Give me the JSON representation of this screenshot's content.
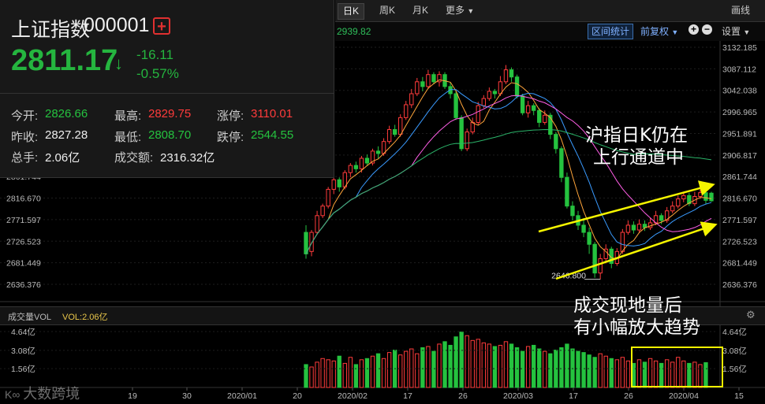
{
  "toolbar": {
    "tabs": [
      "日K",
      "周K",
      "月K",
      "更多"
    ],
    "active": "日K",
    "draw_label": "画线"
  },
  "subbar": {
    "ma_value": "2939.82",
    "range_stats": "区间统计",
    "adjust": "前复权",
    "settings": "设置"
  },
  "quote": {
    "name": "上证指数",
    "code": "000001",
    "price": "2811.17",
    "change": "-16.11",
    "change_pct": "-0.57%",
    "rows": [
      [
        {
          "label": "今开:",
          "value": "2826.66",
          "color": "green"
        },
        {
          "label": "最高:",
          "value": "2829.75",
          "color": "red"
        },
        {
          "label": "涨停:",
          "value": "3110.01",
          "color": "red"
        }
      ],
      [
        {
          "label": "昨收:",
          "value": "2827.28",
          "color": "white"
        },
        {
          "label": "最低:",
          "value": "2808.70",
          "color": "green"
        },
        {
          "label": "跌停:",
          "value": "2544.55",
          "color": "green"
        }
      ],
      [
        {
          "label": "总手:",
          "value": "2.06亿",
          "color": "white"
        },
        {
          "label": "成交额:",
          "value": "2316.32亿",
          "color": "white"
        }
      ]
    ]
  },
  "volume_header": {
    "title": "成交量VOL",
    "vol": "VOL:2.06亿"
  },
  "annotations": {
    "top_line1": "沪指日K仍在",
    "top_line2": "上行通道中",
    "bottom_line1": "成交现地量后",
    "bottom_line2": "有小幅放大趋势",
    "low_label": "2646.800"
  },
  "watermark": "大数跨境",
  "colors": {
    "up": "#ff3b3b",
    "down": "#25c23f",
    "arrow": "#f5f500",
    "box": "#f5f500"
  },
  "chart_data": {
    "type": "candlestick",
    "price_axis_ticks": [
      "3132.185",
      "3087.112",
      "3042.038",
      "2996.965",
      "2951.891",
      "2906.817",
      "2861.744",
      "2816.670",
      "2771.597",
      "2726.523",
      "2681.449",
      "2636.376"
    ],
    "left_price_ticks": [
      "2861.744",
      "2816.670",
      "2771.597",
      "2726.523",
      "2681.449",
      "2636.376"
    ],
    "price_ylim": [
      2636.376,
      3132.185
    ],
    "volume_axis_ticks": [
      "4.64亿",
      "3.08亿",
      "1.56亿"
    ],
    "x_tick_labels": [
      "19",
      "30",
      "2020/01",
      "20",
      "2020/02",
      "17",
      "26",
      "2020/03",
      "17",
      "26",
      "2020/04",
      "15"
    ],
    "candles": [
      {
        "o": 2745,
        "c": 2700,
        "h": 2760,
        "l": 2690
      },
      {
        "o": 2705,
        "c": 2745,
        "h": 2750,
        "l": 2695
      },
      {
        "o": 2745,
        "c": 2780,
        "h": 2790,
        "l": 2740
      },
      {
        "o": 2780,
        "c": 2800,
        "h": 2805,
        "l": 2775
      },
      {
        "o": 2800,
        "c": 2835,
        "h": 2840,
        "l": 2795
      },
      {
        "o": 2835,
        "c": 2855,
        "h": 2865,
        "l": 2825
      },
      {
        "o": 2855,
        "c": 2840,
        "h": 2860,
        "l": 2830
      },
      {
        "o": 2840,
        "c": 2870,
        "h": 2875,
        "l": 2835
      },
      {
        "o": 2870,
        "c": 2885,
        "h": 2890,
        "l": 2860
      },
      {
        "o": 2885,
        "c": 2878,
        "h": 2893,
        "l": 2870
      },
      {
        "o": 2878,
        "c": 2900,
        "h": 2905,
        "l": 2870
      },
      {
        "o": 2900,
        "c": 2890,
        "h": 2908,
        "l": 2885
      },
      {
        "o": 2890,
        "c": 2915,
        "h": 2920,
        "l": 2885
      },
      {
        "o": 2915,
        "c": 2910,
        "h": 2925,
        "l": 2900
      },
      {
        "o": 2910,
        "c": 2935,
        "h": 2942,
        "l": 2905
      },
      {
        "o": 2935,
        "c": 2960,
        "h": 2968,
        "l": 2930
      },
      {
        "o": 2960,
        "c": 2950,
        "h": 2970,
        "l": 2945
      },
      {
        "o": 2950,
        "c": 2985,
        "h": 2992,
        "l": 2945
      },
      {
        "o": 2985,
        "c": 3012,
        "h": 3020,
        "l": 2980
      },
      {
        "o": 3012,
        "c": 3035,
        "h": 3045,
        "l": 3005
      },
      {
        "o": 3035,
        "c": 3060,
        "h": 3068,
        "l": 3030
      },
      {
        "o": 3060,
        "c": 3050,
        "h": 3070,
        "l": 3040
      },
      {
        "o": 3050,
        "c": 3075,
        "h": 3085,
        "l": 3045
      },
      {
        "o": 3075,
        "c": 3060,
        "h": 3080,
        "l": 3055
      },
      {
        "o": 3060,
        "c": 3075,
        "h": 3082,
        "l": 3050
      },
      {
        "o": 3075,
        "c": 3050,
        "h": 3080,
        "l": 3045
      },
      {
        "o": 3050,
        "c": 3035,
        "h": 3058,
        "l": 3025
      },
      {
        "o": 3035,
        "c": 2985,
        "h": 3040,
        "l": 2980
      },
      {
        "o": 2985,
        "c": 2920,
        "h": 2990,
        "l": 2915
      },
      {
        "o": 2920,
        "c": 2955,
        "h": 2962,
        "l": 2915
      },
      {
        "o": 2955,
        "c": 2975,
        "h": 2985,
        "l": 2950
      },
      {
        "o": 2975,
        "c": 3010,
        "h": 3018,
        "l": 2970
      },
      {
        "o": 3010,
        "c": 3025,
        "h": 3032,
        "l": 3005
      },
      {
        "o": 3025,
        "c": 3040,
        "h": 3048,
        "l": 3020
      },
      {
        "o": 3040,
        "c": 3035,
        "h": 3045,
        "l": 3025
      },
      {
        "o": 3035,
        "c": 3060,
        "h": 3072,
        "l": 3030
      },
      {
        "o": 3060,
        "c": 3085,
        "h": 3095,
        "l": 3055
      },
      {
        "o": 3085,
        "c": 3070,
        "h": 3090,
        "l": 3060
      },
      {
        "o": 3070,
        "c": 3030,
        "h": 3075,
        "l": 3025
      },
      {
        "o": 3030,
        "c": 2995,
        "h": 3035,
        "l": 2990
      },
      {
        "o": 2995,
        "c": 3010,
        "h": 3020,
        "l": 2985
      },
      {
        "o": 3010,
        "c": 3000,
        "h": 3015,
        "l": 2990
      },
      {
        "o": 3000,
        "c": 2975,
        "h": 3005,
        "l": 2965
      },
      {
        "o": 2975,
        "c": 2990,
        "h": 3000,
        "l": 2970
      },
      {
        "o": 2990,
        "c": 2950,
        "h": 2995,
        "l": 2940
      },
      {
        "o": 2950,
        "c": 2920,
        "h": 2955,
        "l": 2910
      },
      {
        "o": 2920,
        "c": 2860,
        "h": 2925,
        "l": 2850
      },
      {
        "o": 2860,
        "c": 2800,
        "h": 2870,
        "l": 2795
      },
      {
        "o": 2800,
        "c": 2780,
        "h": 2810,
        "l": 2770
      },
      {
        "o": 2780,
        "c": 2760,
        "h": 2790,
        "l": 2750
      },
      {
        "o": 2760,
        "c": 2745,
        "h": 2775,
        "l": 2735
      },
      {
        "o": 2745,
        "c": 2720,
        "h": 2755,
        "l": 2700
      },
      {
        "o": 2720,
        "c": 2660,
        "h": 2725,
        "l": 2650
      },
      {
        "o": 2660,
        "c": 2690,
        "h": 2700,
        "l": 2646.8
      },
      {
        "o": 2690,
        "c": 2710,
        "h": 2720,
        "l": 2680
      },
      {
        "o": 2710,
        "c": 2680,
        "h": 2715,
        "l": 2670
      },
      {
        "o": 2680,
        "c": 2705,
        "h": 2712,
        "l": 2675
      },
      {
        "o": 2705,
        "c": 2745,
        "h": 2752,
        "l": 2700
      },
      {
        "o": 2745,
        "c": 2760,
        "h": 2770,
        "l": 2740
      },
      {
        "o": 2760,
        "c": 2750,
        "h": 2768,
        "l": 2742
      },
      {
        "o": 2750,
        "c": 2762,
        "h": 2772,
        "l": 2745
      },
      {
        "o": 2762,
        "c": 2755,
        "h": 2770,
        "l": 2748
      },
      {
        "o": 2755,
        "c": 2765,
        "h": 2775,
        "l": 2750
      },
      {
        "o": 2765,
        "c": 2780,
        "h": 2790,
        "l": 2760
      },
      {
        "o": 2780,
        "c": 2770,
        "h": 2785,
        "l": 2762
      },
      {
        "o": 2770,
        "c": 2790,
        "h": 2798,
        "l": 2765
      },
      {
        "o": 2790,
        "c": 2800,
        "h": 2810,
        "l": 2785
      },
      {
        "o": 2800,
        "c": 2815,
        "h": 2822,
        "l": 2795
      },
      {
        "o": 2815,
        "c": 2822,
        "h": 2830,
        "l": 2808
      },
      {
        "o": 2822,
        "c": 2805,
        "h": 2828,
        "l": 2800
      },
      {
        "o": 2805,
        "c": 2820,
        "h": 2830,
        "l": 2800
      },
      {
        "o": 2820,
        "c": 2828,
        "h": 2835,
        "l": 2815
      },
      {
        "o": 2828,
        "c": 2812,
        "h": 2832,
        "l": 2805
      },
      {
        "o": 2827,
        "c": 2811,
        "h": 2830,
        "l": 2809
      }
    ],
    "volumes": [
      1.9,
      1.7,
      2.1,
      2.4,
      2.3,
      2.2,
      2.6,
      2.0,
      2.5,
      1.9,
      2.3,
      2.4,
      2.6,
      2.8,
      2.4,
      2.9,
      3.1,
      2.7,
      3.0,
      3.2,
      2.8,
      3.3,
      3.4,
      3.0,
      3.6,
      3.8,
      3.5,
      4.2,
      4.6,
      4.3,
      3.9,
      4.0,
      3.7,
      3.6,
      3.4,
      3.5,
      3.8,
      3.6,
      3.3,
      3.0,
      3.4,
      3.5,
      3.2,
      3.0,
      2.8,
      3.1,
      3.3,
      3.6,
      3.2,
      3.0,
      2.9,
      2.7,
      2.5,
      2.8,
      2.6,
      2.4,
      2.3,
      2.5,
      2.2,
      2.0,
      2.3,
      2.1,
      2.4,
      2.2,
      2.0,
      2.3,
      2.1,
      2.5,
      2.2,
      2.0,
      2.1,
      1.9,
      2.06
    ]
  }
}
